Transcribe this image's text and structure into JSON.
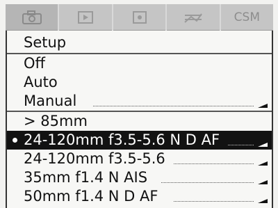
{
  "tabs": [
    {
      "icon": "camera-icon"
    },
    {
      "icon": "playback-icon"
    },
    {
      "icon": "settings-icon"
    },
    {
      "icon": "retouch-icon"
    },
    {
      "label": "CSM"
    }
  ],
  "menu": {
    "title": "Setup",
    "options": [
      "Off",
      "Auto",
      "Manual"
    ],
    "lenses": [
      {
        "label": "> 85mm",
        "selected": false
      },
      {
        "label": "24-120mm f3.5-5.6 N D AF",
        "selected": true
      },
      {
        "label": "24-120mm f3.5-5.6",
        "selected": false
      },
      {
        "label": "35mm f1.4 N AIS",
        "selected": false
      },
      {
        "label": "50mm f1.4 N D AF",
        "selected": false
      }
    ]
  }
}
